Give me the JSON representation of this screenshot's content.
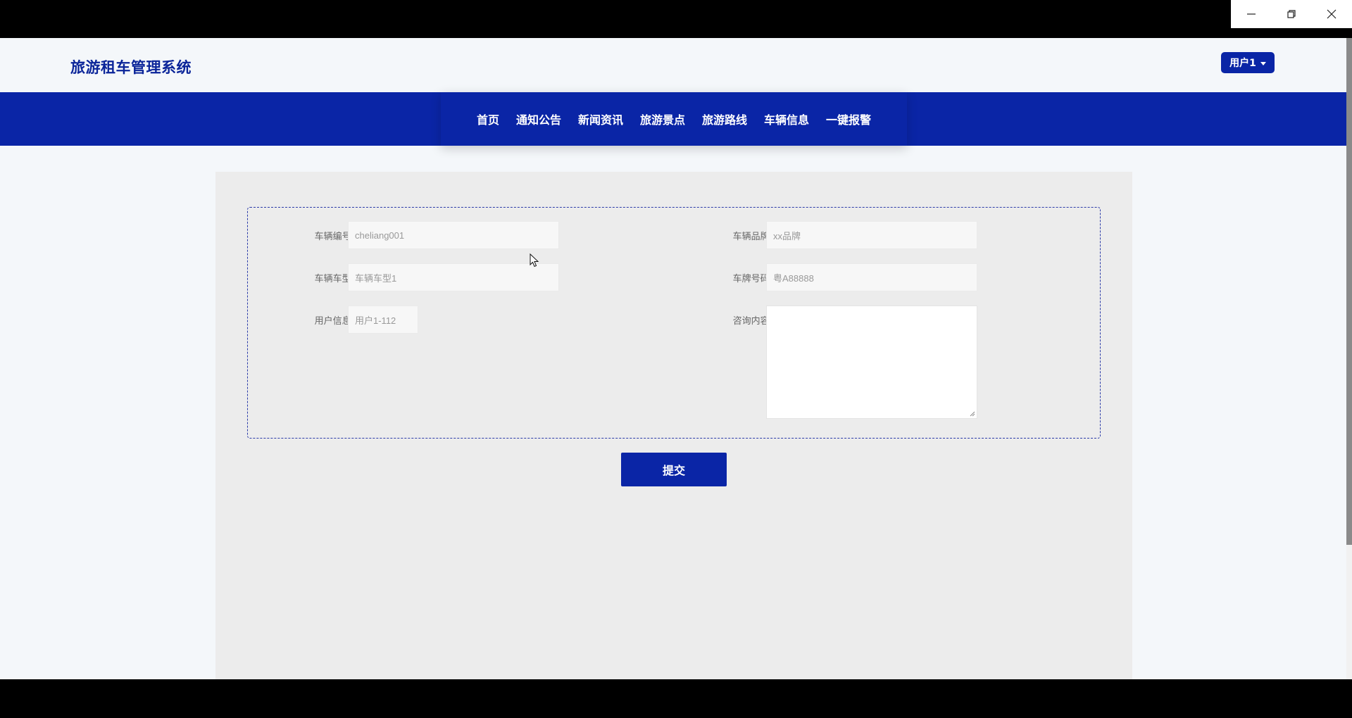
{
  "window_controls": {
    "minimize": "minimize",
    "restore": "restore",
    "close": "close"
  },
  "header": {
    "brand": "旅游租车管理系统",
    "user_menu": "用户1"
  },
  "nav": {
    "items": [
      "首页",
      "通知公告",
      "新闻资讯",
      "旅游景点",
      "旅游路线",
      "车辆信息",
      "一键报警"
    ]
  },
  "form": {
    "vehicle_no": {
      "label": "车辆编号:",
      "value": "cheliang001"
    },
    "vehicle_brand": {
      "label": "车辆品牌:",
      "value": "xx品牌"
    },
    "vehicle_model": {
      "label": "车辆车型:",
      "value": "车辆车型1"
    },
    "plate_no": {
      "label": "车牌号码:",
      "value": "粤A88888"
    },
    "user_info": {
      "label": "用户信息:",
      "value": "用户1-112"
    },
    "inquiry": {
      "label": "咨询内容:",
      "value": ""
    },
    "submit_label": "提交"
  },
  "colors": {
    "primary": "#0a25a6",
    "brand_text": "#0a2499",
    "page_bg": "#f4f7fa",
    "panel_bg": "#ececec"
  }
}
